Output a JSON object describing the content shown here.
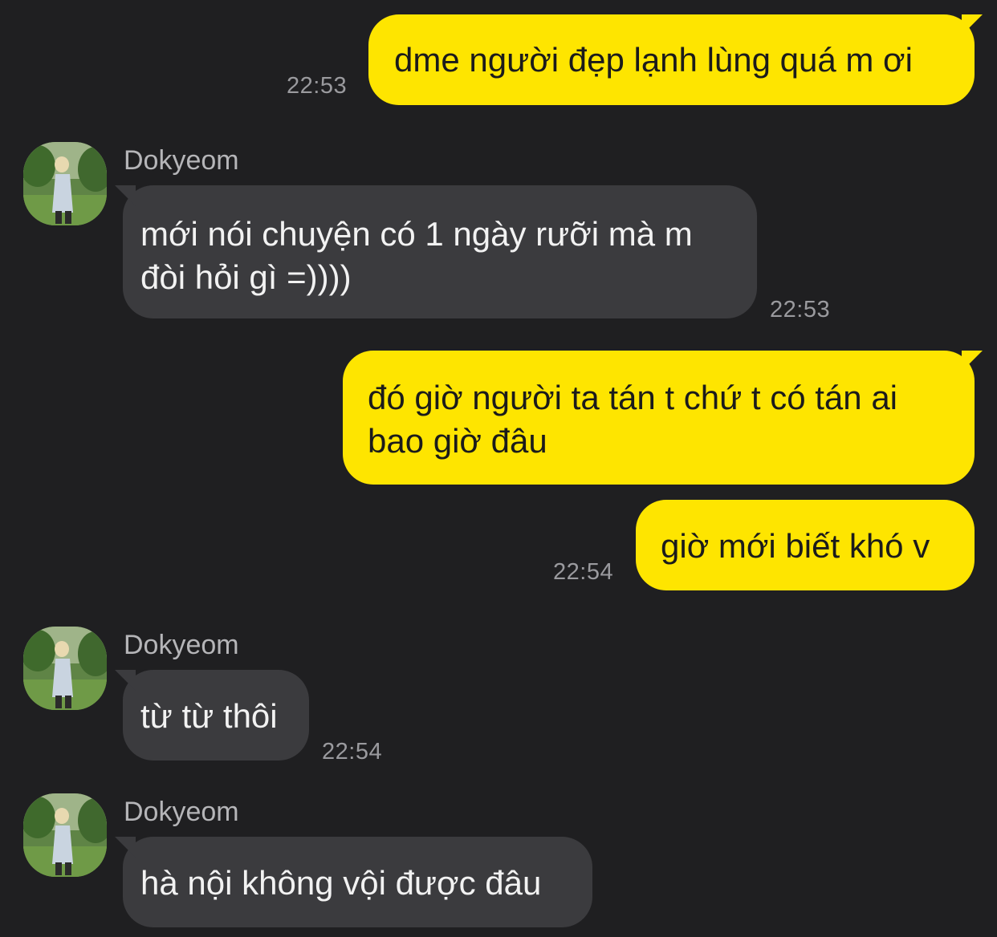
{
  "messages": [
    {
      "id": "m1",
      "direction": "outgoing",
      "text": "dme người đẹp lạnh lùng quá m ơi",
      "time": "22:53"
    },
    {
      "id": "m2",
      "direction": "incoming",
      "sender": "Dokyeom",
      "lines": [
        "mới nói chuyện có 1 ngày rưỡi mà m",
        "đòi hỏi gì =))))"
      ],
      "time": "22:53"
    },
    {
      "id": "m3",
      "direction": "outgoing",
      "lines": [
        "đó giờ người ta tán t chứ t có tán ai",
        "bao giờ đâu"
      ]
    },
    {
      "id": "m4",
      "direction": "outgoing",
      "text": "giờ mới biết khó v",
      "time": "22:54"
    },
    {
      "id": "m5",
      "direction": "incoming",
      "sender": "Dokyeom",
      "text": "từ từ thôi",
      "time": "22:54"
    },
    {
      "id": "m6",
      "direction": "incoming",
      "sender": "Dokyeom",
      "text": "hà nội không vội được đâu"
    }
  ],
  "colors": {
    "background": "#1f1f21",
    "outgoing_bubble": "#fee500",
    "incoming_bubble": "#3b3b3e",
    "timestamp": "#9a9a9e"
  },
  "icons": {
    "avatar": "profile-photo-person-in-garden"
  }
}
